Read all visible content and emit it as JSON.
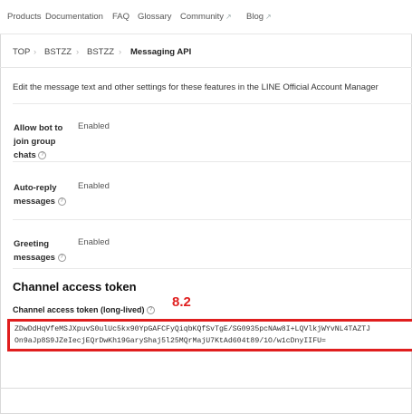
{
  "nav": {
    "products": "Products",
    "documentation": "Documentation",
    "faq": "FAQ",
    "glossary": "Glossary",
    "community": "Community",
    "blog": "Blog",
    "external_glyph": "↗"
  },
  "breadcrumb": {
    "top": "TOP",
    "provider": "BSTZZ",
    "channel": "BSTZZ",
    "page": "Messaging API",
    "separator": "›"
  },
  "intro_text": "Edit the message text and other settings for these features in the LINE Official Account Manager",
  "settings": [
    {
      "label": "Allow bot to join group chats",
      "value": "Enabled"
    },
    {
      "label": "Auto-reply messages",
      "value": "Enabled"
    },
    {
      "label": "Greeting messages",
      "value": "Enabled"
    }
  ],
  "info_glyph": "?",
  "channel_token": {
    "section_title": "Channel access token",
    "label": "Channel access token (long-lived)",
    "step_badge": "8.2",
    "line1": "ZDwDdHqVfeMSJXpuvS0ulUc5kx90YpGAFCFyQiqbKQfSvTgE/SG0935pcNAw8I+LQVlkjWYvNL4TAZTJ",
    "line2": "On9aJp8S9JZeIecjEQrDwKh19GaryShaj5l25MQrMajU7KtAd604t89/1O/w1cDnyIIFU="
  },
  "colors": {
    "highlight": "#e01e1e",
    "step_badge": "#e02020"
  }
}
